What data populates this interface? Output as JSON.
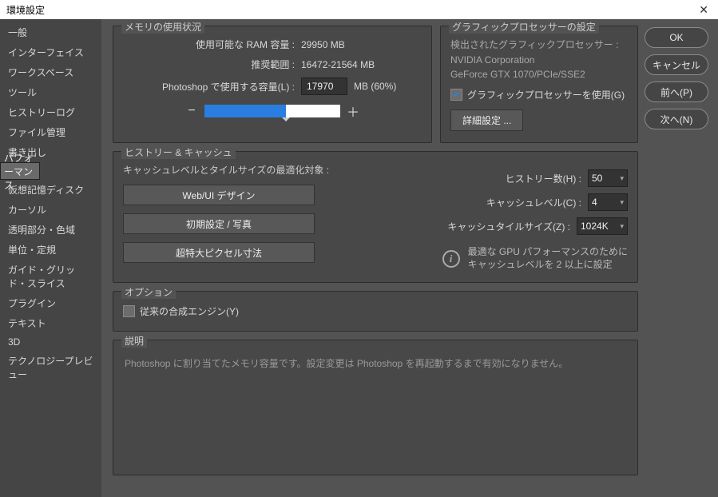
{
  "title": "環境設定",
  "buttons": {
    "ok": "OK",
    "cancel": "キャンセル",
    "prev": "前へ(P)",
    "next": "次へ(N)"
  },
  "sidebar": [
    "一般",
    "インターフェイス",
    "ワークスペース",
    "ツール",
    "ヒストリーログ",
    "ファイル管理",
    "書き出し",
    "パフォーマンス",
    "仮想記憶ディスク",
    "カーソル",
    "透明部分・色域",
    "単位・定規",
    "ガイド・グリッド・スライス",
    "プラグイン",
    "テキスト",
    "3D",
    "テクノロジープレビュー"
  ],
  "selectedSidebarIndex": 7,
  "mem": {
    "title": "メモリの使用状況",
    "availLabel": "使用可能な RAM 容量 :",
    "availValue": "29950 MB",
    "rangeLabel": "推奨範囲 :",
    "rangeValue": "16472-21564 MB",
    "useLabel": "Photoshop で使用する容量(L) :",
    "useValue": "17970",
    "useSuffix": "MB (60%)",
    "sliderPct": 60
  },
  "gpu": {
    "title": "グラフィックプロセッサーの設定",
    "detected": "検出されたグラフィックプロセッサー :",
    "vendor": "NVIDIA Corporation",
    "card": "GeForce GTX 1070/PCIe/SSE2",
    "useGpu": "グラフィックプロセッサーを使用(G)",
    "useGpuChecked": true,
    "adv": "詳細設定 ..."
  },
  "hist": {
    "title": "ヒストリー & キャッシュ",
    "sub": "キャッシュレベルとタイルサイズの最適化対象 :",
    "b1": "Web/UI デザイン",
    "b2": "初期設定 / 写真",
    "b3": "超特大ピクセル寸法",
    "r1l": "ヒストリー数(H) :",
    "r1v": "50",
    "r2l": "キャッシュレベル(C) :",
    "r2v": "4",
    "r3l": "キャッシュタイルサイズ(Z) :",
    "r3v": "1024K",
    "info1": "最適な GPU パフォーマンスのために",
    "info2": "キャッシュレベルを 2 以上に設定"
  },
  "opt": {
    "title": "オプション",
    "legacy": "従来の合成エンジン(Y)",
    "checked": false
  },
  "help": {
    "title": "説明",
    "text": "Photoshop に割り当てたメモリ容量です。設定変更は Photoshop を再起動するまで有効になりません。"
  }
}
